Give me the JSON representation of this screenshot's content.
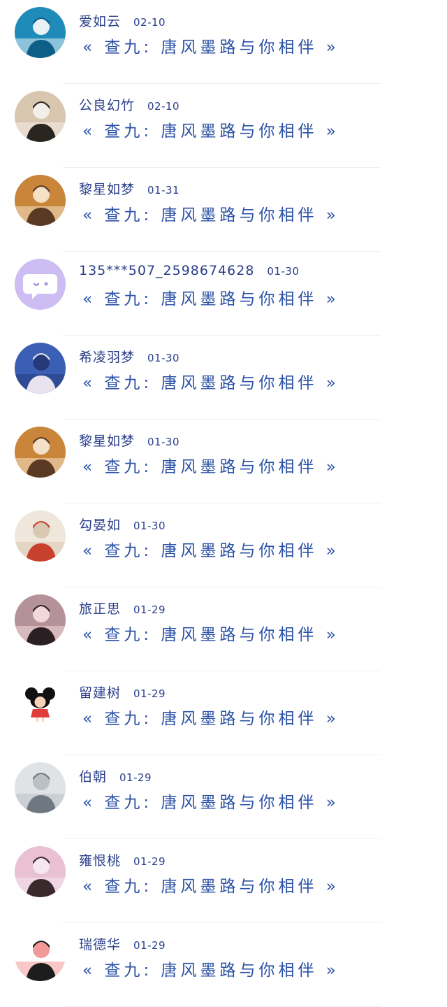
{
  "messages": [
    {
      "name": "爱如云",
      "date": "02-10",
      "text": "« 查九: 唐风墨路与你相伴 »",
      "avatar": "dancer-photo",
      "colors": [
        "#1f8bb8",
        "#0d5f88",
        "#e8f2f6"
      ]
    },
    {
      "name": "公良幻竹",
      "date": "02-10",
      "text": "« 查九: 唐风墨路与你相伴 »",
      "avatar": "man-cello-photo",
      "colors": [
        "#d9c6ae",
        "#2b2520",
        "#f2efe9"
      ]
    },
    {
      "name": "黎星如梦",
      "date": "01-31",
      "text": "« 查九: 唐风墨路与你相伴 »",
      "avatar": "girl-sunset-photo",
      "colors": [
        "#c9853a",
        "#5a3a22",
        "#f4e1c8"
      ]
    },
    {
      "name": "135***507_2598674628",
      "date": "01-30",
      "text": "« 查九: 唐风墨路与你相伴 »",
      "avatar": "default-chat-avatar",
      "colors": [
        "#cdbdf2",
        "#ffffff",
        "#a894e0"
      ]
    },
    {
      "name": "希凌羽梦",
      "date": "01-30",
      "text": "« 查九: 唐风墨路与你相伴 »",
      "avatar": "anime-boy-avatar",
      "colors": [
        "#3c5fb6",
        "#e9e3f0",
        "#263a7a"
      ]
    },
    {
      "name": "黎星如梦",
      "date": "01-30",
      "text": "« 查九: 唐风墨路与你相伴 »",
      "avatar": "girl-sunset-photo",
      "colors": [
        "#c9853a",
        "#5a3a22",
        "#f4e1c8"
      ]
    },
    {
      "name": "勾晏如",
      "date": "01-30",
      "text": "« 查九: 唐风墨路与你相伴 »",
      "avatar": "red-dress-figure",
      "colors": [
        "#efe7dc",
        "#c8402e",
        "#d9c9b3"
      ]
    },
    {
      "name": "旅正思",
      "date": "01-29",
      "text": "« 查九: 唐风墨路与你相伴 »",
      "avatar": "anime-girl-avatar",
      "colors": [
        "#b5929a",
        "#2a2024",
        "#f3d8da"
      ]
    },
    {
      "name": "留建树",
      "date": "01-29",
      "text": "« 查九: 唐风墨路与你相伴 »",
      "avatar": "cartoon-doll-avatar",
      "colors": [
        "#ffffff",
        "#111111",
        "#e23b3b"
      ]
    },
    {
      "name": "伯朝",
      "date": "01-29",
      "text": "« 查九: 唐风墨路与你相伴 »",
      "avatar": "window-silhouette-photo",
      "colors": [
        "#dfe3e6",
        "#6f7880",
        "#b9c1c7"
      ]
    },
    {
      "name": "雍恨桃",
      "date": "01-29",
      "text": "« 查九: 唐风墨路与你相伴 »",
      "avatar": "girl-portrait-photo",
      "colors": [
        "#e9c1d3",
        "#3a2a2e",
        "#f6e6ee"
      ]
    },
    {
      "name": "瑞德华",
      "date": "01-29",
      "text": "« 查九: 唐风墨路与你相伴 »",
      "avatar": "cartoon-boy-avatar",
      "colors": [
        "#ffffff",
        "#1d1d1d",
        "#f29a9a"
      ]
    }
  ]
}
